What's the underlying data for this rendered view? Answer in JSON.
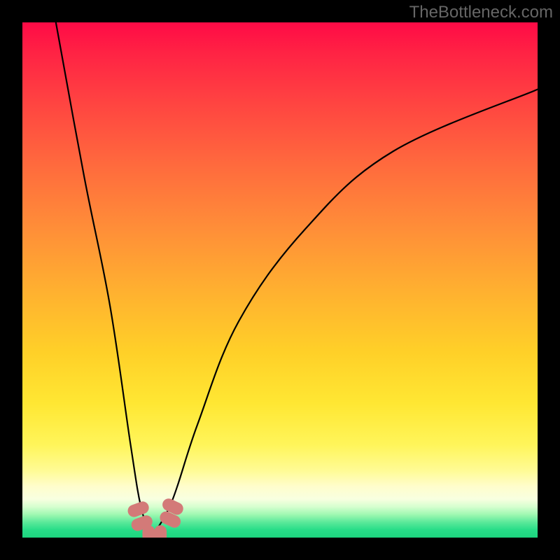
{
  "watermark": "TheBottleneck.com",
  "chart_data": {
    "type": "line",
    "title": "",
    "xlabel": "",
    "ylabel": "",
    "xlim": [
      0,
      100
    ],
    "ylim": [
      0,
      100
    ],
    "grid": false,
    "legend": false,
    "curve": {
      "type": "v-shape",
      "minimum_x_pct": 25,
      "left_branch": [
        {
          "x_pct": 6.5,
          "y_pct": 100
        },
        {
          "x_pct": 12,
          "y_pct": 70
        },
        {
          "x_pct": 17,
          "y_pct": 45
        },
        {
          "x_pct": 21,
          "y_pct": 18
        },
        {
          "x_pct": 23,
          "y_pct": 6
        },
        {
          "x_pct": 25,
          "y_pct": 0
        }
      ],
      "right_branch": [
        {
          "x_pct": 25,
          "y_pct": 0
        },
        {
          "x_pct": 29,
          "y_pct": 7
        },
        {
          "x_pct": 34,
          "y_pct": 22
        },
        {
          "x_pct": 42,
          "y_pct": 42
        },
        {
          "x_pct": 55,
          "y_pct": 60
        },
        {
          "x_pct": 72,
          "y_pct": 75
        },
        {
          "x_pct": 100,
          "y_pct": 87
        }
      ]
    },
    "bottom_markers": [
      {
        "x_pct": 22.5,
        "y_pct": 5.5
      },
      {
        "x_pct": 23.2,
        "y_pct": 2.8
      },
      {
        "x_pct": 24.5,
        "y_pct": 0.3
      },
      {
        "x_pct": 26.8,
        "y_pct": 0.3
      },
      {
        "x_pct": 28.7,
        "y_pct": 3.5
      },
      {
        "x_pct": 29.2,
        "y_pct": 6.0
      }
    ],
    "marker_style": {
      "shape": "rounded-capsule",
      "fill": "#d37a78",
      "width_pct": 2.4,
      "height_pct": 4.2
    },
    "gradient_stops": [
      {
        "pct": 0,
        "color": "#ff0a46"
      },
      {
        "pct": 16,
        "color": "#ff4541"
      },
      {
        "pct": 40,
        "color": "#ff8e38"
      },
      {
        "pct": 64,
        "color": "#ffd028"
      },
      {
        "pct": 82,
        "color": "#fff55a"
      },
      {
        "pct": 92.5,
        "color": "#f8ffe0"
      },
      {
        "pct": 97,
        "color": "#5be99a"
      },
      {
        "pct": 100,
        "color": "#1cd47e"
      }
    ]
  }
}
